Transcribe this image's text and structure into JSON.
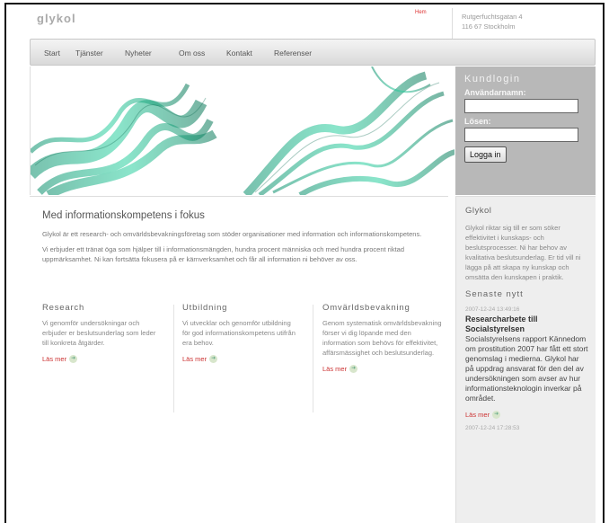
{
  "header": {
    "logo": "glykol",
    "top_mark": "Hem",
    "address": [
      "Rutgerfuchtsgatan 4",
      "116 67 Stockholm"
    ]
  },
  "nav": {
    "items": [
      "Start",
      "Tjänster",
      "Nyheter",
      "Om oss",
      "Kontakt",
      "Referenser"
    ]
  },
  "login": {
    "title": "Kundlogin",
    "username_label": "Användarnamn:",
    "password_label": "Lösen:",
    "username_value": "",
    "password_value": "",
    "submit_label": "Logga in"
  },
  "main": {
    "title": "Med informationskompetens i fokus",
    "intro": [
      "Glykol är ett research- och omvärldsbevakningsföretag som stöder organisationer med information och informationskompetens.",
      "Vi erbjuder ett tränat öga som hjälper till i informationsmängden, hundra procent människa och med hundra procent riktad uppmärksamhet. Ni kan fortsätta fokusera på er kärnverksamhet och får all information ni behöver av oss."
    ],
    "columns": [
      {
        "title": "Research",
        "text": "Vi genomför undersökningar och erbjuder er beslutsunderlag som leder till konkreta åtgärder.",
        "link": "Läs mer"
      },
      {
        "title": "Utbildning",
        "text": "Vi utvecklar och genomför utbildning för god informationskompetens utifrån era behov.",
        "link": "Läs mer"
      },
      {
        "title": "Omvärldsbevakning",
        "text": "Genom systematisk omvärldsbevakning förser vi dig löpande med den information som behövs för effektivitet, affärsmässighet och beslutsunderlag.",
        "link": "Läs mer"
      }
    ]
  },
  "sidebar": {
    "title": "Glykol",
    "text": "Glykol riktar sig till er som söker effektivitet i kunskaps- och beslutsprocesser. Ni har behov av kvalitativa beslutsunderlag. Er tid vill ni lägga på att skapa ny kunskap och omsätta den kunskapen i praktik.",
    "news_title": "Senaste nytt",
    "news": {
      "date": "2007-12-24 13:49:16",
      "headline": "Researcharbete till Socialstyrelsen",
      "body": "Socialstyrelsens rapport Kännedom om prostitution 2007 har fått ett stort genomslag i medierna. Glykol har på uppdrag ansvarat för den del av undersökningen som avser av hur informationsteknologin inverkar på området.",
      "link": "Läs mer"
    },
    "next_date": "2007-12-24 17:28:53"
  },
  "colors": {
    "accent_red": "#cc3333",
    "login_bg": "#b8b8b8",
    "sidebar_bg": "#eeeeee",
    "hero_green": "#1aa884"
  },
  "icons": {
    "read_more": "arrow-circle-icon"
  }
}
